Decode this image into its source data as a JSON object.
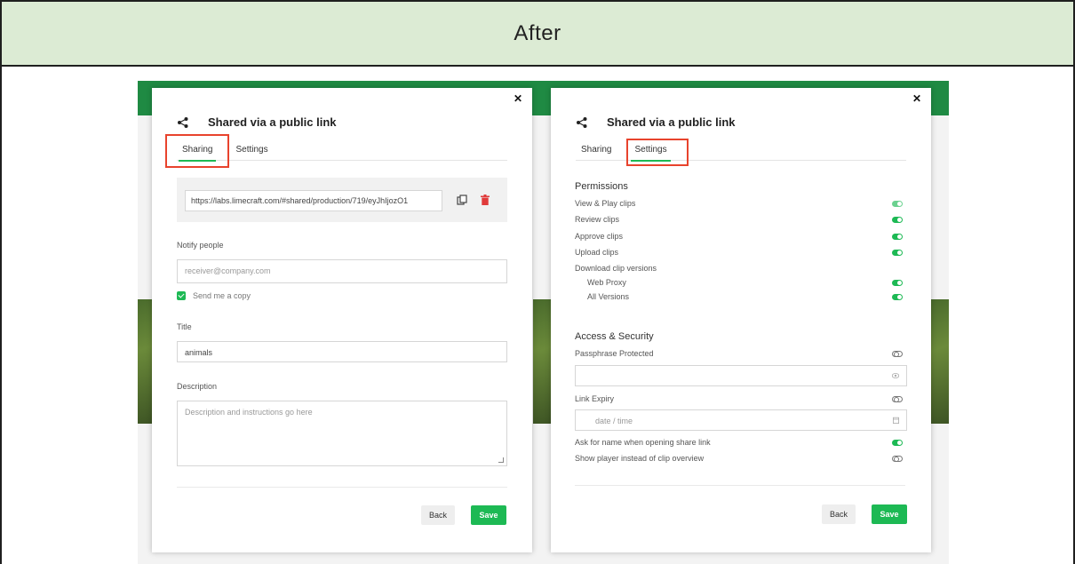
{
  "header": {
    "title": "After"
  },
  "left_modal": {
    "title": "Shared via a public link",
    "tabs": [
      {
        "label": "Sharing",
        "active": true
      },
      {
        "label": "Settings",
        "active": false
      }
    ],
    "url": "https://labs.limecraft.com/#shared/production/719/eyJhIjozO1",
    "notify_label": "Notify people",
    "notify_placeholder": "receiver@company.com",
    "copy_label": "Send me a copy",
    "title_label": "Title",
    "title_value": "animals",
    "description_label": "Description",
    "description_placeholder": "Description and instructions go here",
    "back_label": "Back",
    "save_label": "Save"
  },
  "right_modal": {
    "title": "Shared via a public link",
    "tabs": [
      {
        "label": "Sharing",
        "active": false
      },
      {
        "label": "Settings",
        "active": true
      }
    ],
    "permissions_heading": "Permissions",
    "permissions": [
      {
        "label": "View & Play clips",
        "on": true
      },
      {
        "label": "Review clips",
        "on": true
      },
      {
        "label": "Approve clips",
        "on": true
      },
      {
        "label": "Upload clips",
        "on": true
      },
      {
        "label": "Download clip versions"
      },
      {
        "label": "Web Proxy",
        "on": true
      },
      {
        "label": "All Versions",
        "on": true
      }
    ],
    "access_heading": "Access & Security",
    "passphrase_label": "Passphrase Protected",
    "expiry_label": "Link Expiry",
    "expiry_placeholder": "date / time",
    "ask_name_label": "Ask for name when opening share link",
    "show_player_label": "Show player instead of clip overview",
    "back_label": "Back",
    "save_label": "Save"
  },
  "colors": {
    "accent": "#1db954",
    "highlight": "#e8432d",
    "header_bg": "#dcebd4",
    "app_green": "#1f8a43"
  }
}
